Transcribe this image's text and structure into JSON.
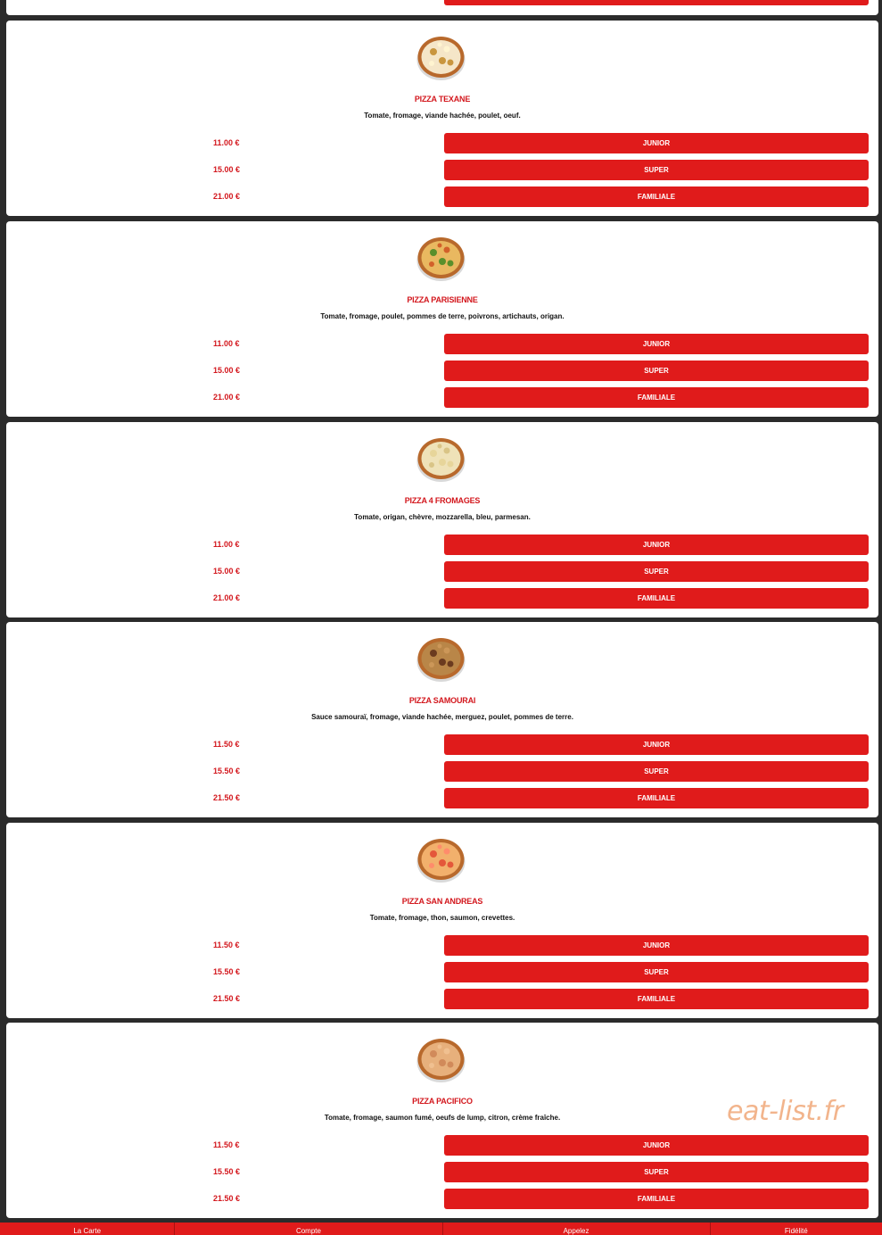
{
  "menu": {
    "items": [
      {
        "name": "PIZZA TEXANE",
        "image_icon": "pizza-texane-icon",
        "description": "Tomate, fromage, viande hachée, poulet, oeuf.",
        "sizes": [
          {
            "price": "11.00 €",
            "label": "JUNIOR"
          },
          {
            "price": "15.00 €",
            "label": "SUPER"
          },
          {
            "price": "21.00 €",
            "label": "FAMILIALE"
          }
        ]
      },
      {
        "name": "PIZZA PARISIENNE",
        "image_icon": "pizza-parisienne-icon",
        "description": "Tomate, fromage, poulet, pommes de terre, poivrons, artichauts, origan.",
        "sizes": [
          {
            "price": "11.00 €",
            "label": "JUNIOR"
          },
          {
            "price": "15.00 €",
            "label": "SUPER"
          },
          {
            "price": "21.00 €",
            "label": "FAMILIALE"
          }
        ]
      },
      {
        "name": "PIZZA 4 FROMAGES",
        "image_icon": "pizza-4-fromages-icon",
        "description": "Tomate, origan, chèvre, mozzarella, bleu, parmesan.",
        "sizes": [
          {
            "price": "11.00 €",
            "label": "JUNIOR"
          },
          {
            "price": "15.00 €",
            "label": "SUPER"
          },
          {
            "price": "21.00 €",
            "label": "FAMILIALE"
          }
        ]
      },
      {
        "name": "PIZZA SAMOURAI",
        "image_icon": "pizza-samourai-icon",
        "description": "Sauce samouraï, fromage, viande hachée, merguez, poulet, pommes de terre.",
        "sizes": [
          {
            "price": "11.50 €",
            "label": "JUNIOR"
          },
          {
            "price": "15.50 €",
            "label": "SUPER"
          },
          {
            "price": "21.50 €",
            "label": "FAMILIALE"
          }
        ]
      },
      {
        "name": "PIZZA SAN ANDREAS",
        "image_icon": "pizza-san-andreas-icon",
        "description": "Tomate, fromage, thon, saumon, crevettes.",
        "sizes": [
          {
            "price": "11.50 €",
            "label": "JUNIOR"
          },
          {
            "price": "15.50 €",
            "label": "SUPER"
          },
          {
            "price": "21.50 €",
            "label": "FAMILIALE"
          }
        ]
      },
      {
        "name": "PIZZA PACIFICO",
        "image_icon": "pizza-pacifico-icon",
        "description": "Tomate, fromage, saumon fumé, oeufs de lump, citron, crème fraîche.",
        "sizes": [
          {
            "price": "11.50 €",
            "label": "JUNIOR"
          },
          {
            "price": "15.50 €",
            "label": "SUPER"
          },
          {
            "price": "21.50 €",
            "label": "FAMILIALE"
          }
        ]
      }
    ]
  },
  "watermark": "eat-list.fr",
  "bottom_nav": {
    "items": [
      "La Carte",
      "Compte",
      "Appelez",
      "Fidélité"
    ]
  },
  "colors": {
    "accent": "#e01b1b",
    "title": "#d3171d",
    "background": "#2b2b2b"
  }
}
